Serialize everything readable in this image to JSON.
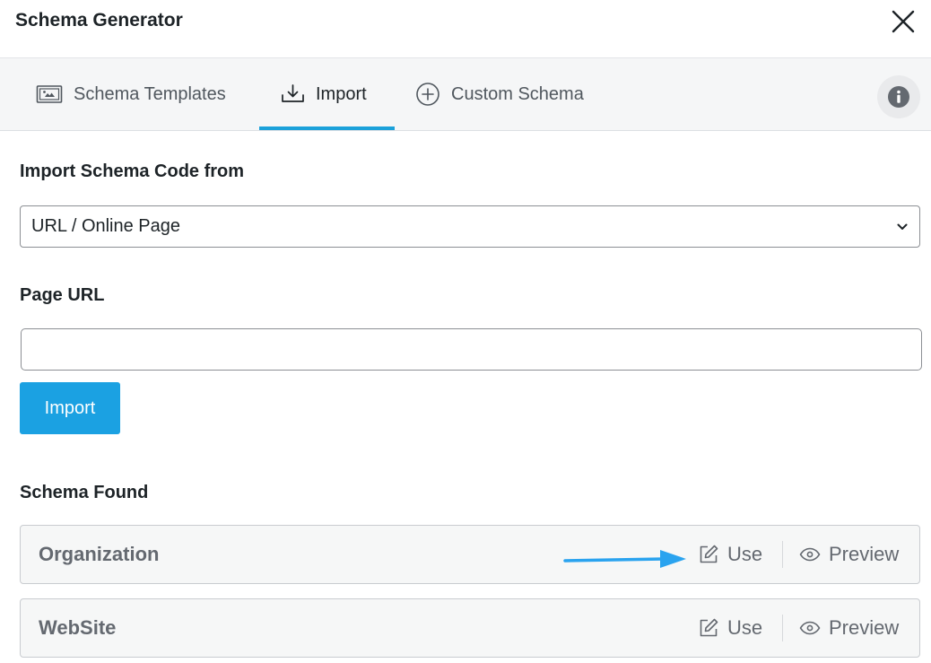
{
  "header": {
    "title": "Schema Generator",
    "close_icon": "close-icon"
  },
  "tabs": [
    {
      "label": "Schema Templates",
      "icon": "template-icon",
      "active": false
    },
    {
      "label": "Import",
      "icon": "import-icon",
      "active": true
    },
    {
      "label": "Custom Schema",
      "icon": "plus-circle-icon",
      "active": false
    }
  ],
  "info_icon": "info-icon",
  "import_form": {
    "source_label": "Import Schema Code from",
    "source_value": "URL / Online Page",
    "url_label": "Page URL",
    "url_value": "",
    "import_button": "Import"
  },
  "schema_found": {
    "heading": "Schema Found",
    "items": [
      {
        "name": "Organization",
        "use_label": "Use",
        "preview_label": "Preview"
      },
      {
        "name": "WebSite",
        "use_label": "Use",
        "preview_label": "Preview"
      }
    ]
  },
  "colors": {
    "accent": "#1ba1e2",
    "tab_underline": "#1ba1da",
    "annotation_arrow": "#2aa3ef"
  }
}
